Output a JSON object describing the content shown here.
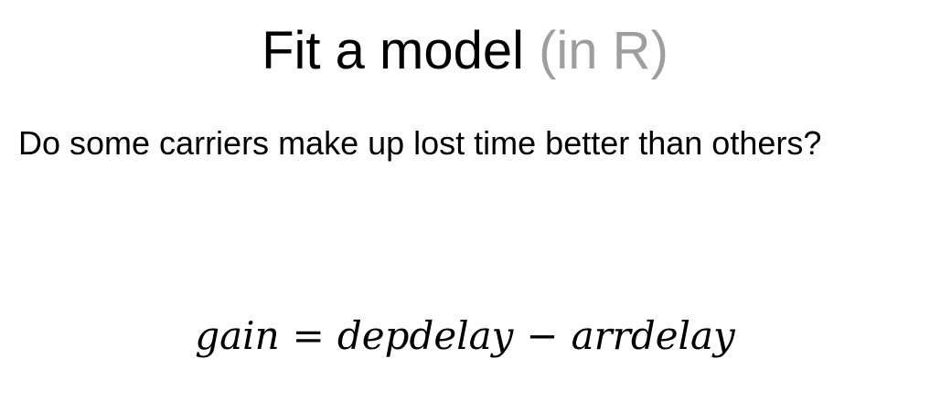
{
  "slide": {
    "title_main": "Fit a model",
    "title_muted": "(in R)",
    "question": "Do some carriers make up lost time better than others?",
    "equation": {
      "lhs": "gain",
      "equals": "=",
      "term1": "depdelay",
      "minus": "−",
      "term2": "arrdelay"
    }
  }
}
